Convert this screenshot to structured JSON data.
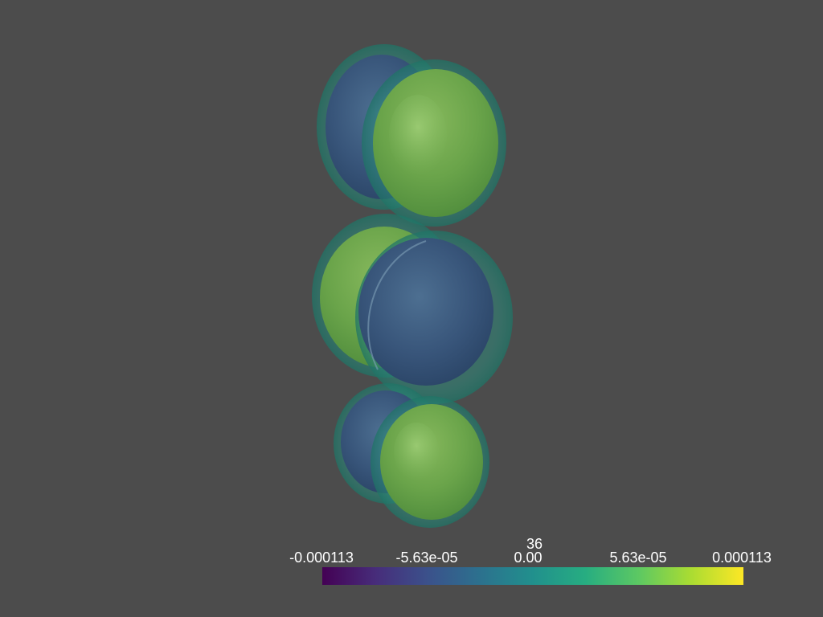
{
  "scalar_bar": {
    "title": "36",
    "tick_labels": [
      "-0.000113",
      "-5.63e-05",
      "0.00",
      "5.63e-05",
      "0.000113"
    ],
    "colormap": "viridis",
    "colormap_stops": [
      "#440154",
      "#472c7a",
      "#3b518b",
      "#2c718e",
      "#21908d",
      "#27ad81",
      "#5cc863",
      "#aadc32",
      "#fde725"
    ],
    "range": [
      -0.000113,
      0.000113
    ]
  },
  "scene": {
    "background_color": "#4c4c4c",
    "objects": [
      "top-lobe-pair",
      "middle-lobe-pair",
      "bottom-lobe-pair"
    ],
    "negative_lobe_color": "#3b5a7a",
    "positive_lobe_color": "#6fa84a",
    "shell_color": "#2a8a7a"
  }
}
